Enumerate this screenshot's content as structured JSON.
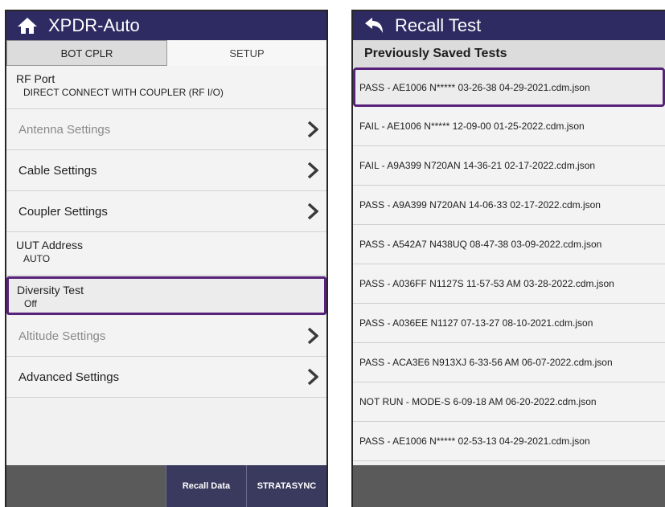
{
  "left": {
    "title": "XPDR-Auto",
    "tabs": [
      {
        "label": "BOT CPLR",
        "active": true
      },
      {
        "label": "SETUP",
        "active": false
      }
    ],
    "rf_port": {
      "label": "RF Port",
      "value": "DIRECT CONNECT WITH COUPLER (RF I/O)"
    },
    "antenna_settings": "Antenna Settings",
    "cable_settings": "Cable Settings",
    "coupler_settings": "Coupler Settings",
    "uut_address": {
      "label": "UUT Address",
      "value": "AUTO"
    },
    "diversity_test": {
      "label": "Diversity Test",
      "value": "Off"
    },
    "altitude_settings": "Altitude Settings",
    "advanced_settings": "Advanced Settings",
    "bottom": {
      "recall": "Recall Data",
      "stratasync": "STRATASYNC"
    }
  },
  "right": {
    "title": "Recall Test",
    "header": "Previously Saved Tests",
    "files": [
      "PASS - AE1006 N***** 03-26-38  04-29-2021.cdm.json",
      "FAIL - AE1006 N***** 12-09-00  01-25-2022.cdm.json",
      "FAIL - A9A399 N720AN 14-36-21  02-17-2022.cdm.json",
      "PASS - A9A399 N720AN 14-06-33  02-17-2022.cdm.json",
      "PASS - A542A7 N438UQ 08-47-38  03-09-2022.cdm.json",
      "PASS - A036FF N1127S 11-57-53 AM  03-28-2022.cdm.json",
      "PASS - A036EE N1127 07-13-27  08-10-2021.cdm.json",
      "PASS - ACA3E6 N913XJ 6-33-56 AM  06-07-2022.cdm.json",
      "NOT RUN - MODE-S 6-09-18 AM  06-20-2022.cdm.json",
      "PASS - AE1006 N***** 02-53-13  04-29-2021.cdm.json"
    ]
  },
  "colors": {
    "titlebar": "#2e2b62",
    "selection": "#58217a",
    "bottombar": "#5a5a5a"
  }
}
